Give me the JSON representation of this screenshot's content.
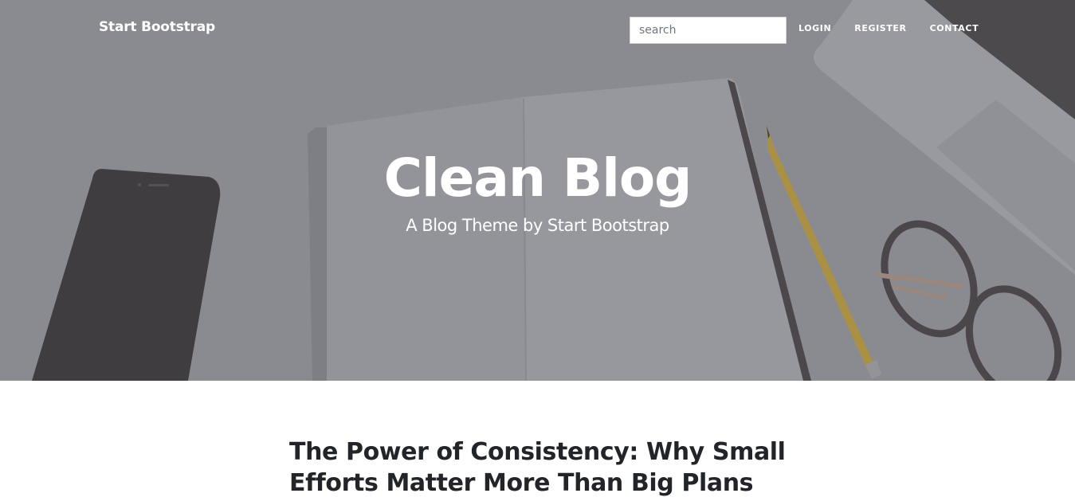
{
  "navbar": {
    "brand": "Start Bootstrap",
    "search_placeholder": "search",
    "links": [
      "LOGIN",
      "REGISTER",
      "CONTACT"
    ]
  },
  "header": {
    "title": "Clean Blog",
    "subtitle": "A Blog Theme by Start Bootstrap"
  },
  "posts": [
    {
      "title": "The Power of Consistency: Why Small Efforts Matter More Than Big Plans"
    }
  ],
  "colors": {
    "overlay": "#8a8c91",
    "heading_text": "#ffffff",
    "post_title": "#212529"
  }
}
